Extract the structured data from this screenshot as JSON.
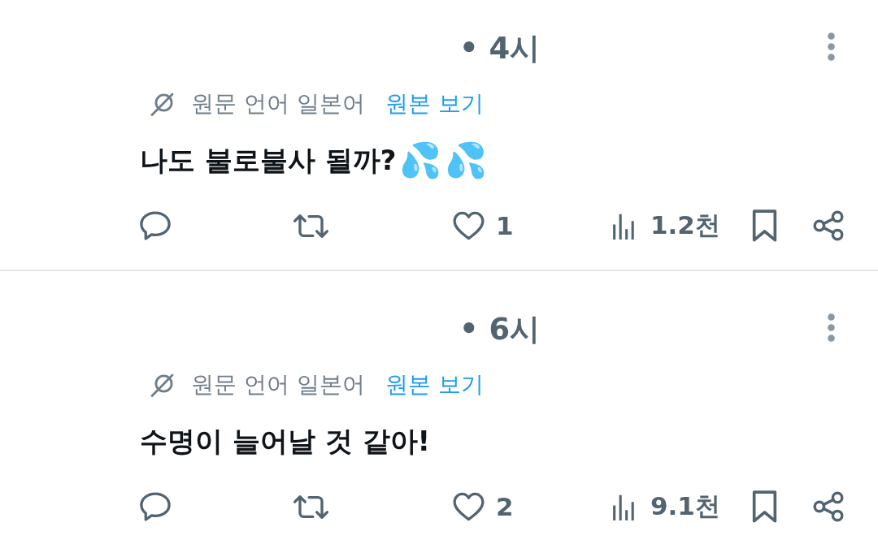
{
  "posts": [
    {
      "timestamp": "• 4시",
      "translation": {
        "note": "원문 언어 일본어",
        "link": "원본 보기"
      },
      "text": "나도 불로불사 될까?",
      "emojis": [
        "💦",
        "💦"
      ],
      "actions": [
        {
          "kind": "reply"
        },
        {
          "kind": "repost"
        },
        {
          "kind": "like",
          "count": "1"
        },
        {
          "kind": "views",
          "count": "1.2천"
        },
        {
          "kind": "bookmark"
        },
        {
          "kind": "share"
        }
      ]
    },
    {
      "timestamp": "• 6시",
      "translation": {
        "note": "원문 언어 일본어",
        "link": "원본 보기"
      },
      "text": "수명이 늘어날 것 같아!",
      "actions": [
        {
          "kind": "reply"
        },
        {
          "kind": "repost"
        },
        {
          "kind": "like",
          "count": "2"
        },
        {
          "kind": "views",
          "count": "9.1천"
        },
        {
          "kind": "bookmark"
        },
        {
          "kind": "share"
        }
      ]
    }
  ]
}
